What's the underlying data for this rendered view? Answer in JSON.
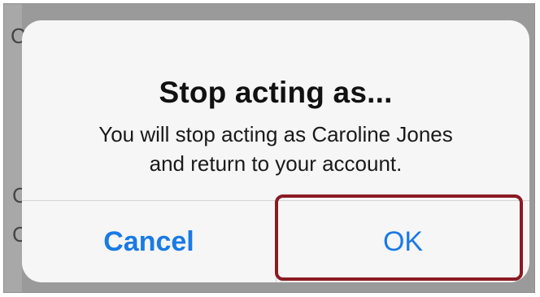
{
  "dialog": {
    "title": "Stop acting as...",
    "message_line1": "You will stop acting as Caroline Jones",
    "message_line2": "and return to your account.",
    "cancel_label": "Cancel",
    "ok_label": "OK"
  },
  "colors": {
    "button_blue": "#1a7ae6",
    "highlight_red": "#8b1a22",
    "dialog_bg": "#f6f6f6",
    "backdrop": "#9a9a9a"
  }
}
